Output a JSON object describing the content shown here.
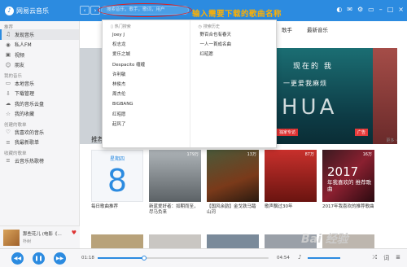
{
  "app": {
    "name": "网易云音乐"
  },
  "search": {
    "placeholder": "搜索音乐，歌手，歌词，用户"
  },
  "annotation": {
    "text": "输入需要下载的歌曲名称"
  },
  "nav": {
    "back": "‹",
    "forward": "›"
  },
  "sidebar": {
    "section_recommend": "推荐",
    "recommend_items": [
      {
        "icon": "music-note-icon",
        "label": "发现音乐"
      },
      {
        "icon": "radio-icon",
        "label": "私人FM"
      },
      {
        "icon": "video-icon",
        "label": "视频"
      },
      {
        "icon": "friends-icon",
        "label": "朋友"
      }
    ],
    "section_my_music": "我的音乐",
    "my_music_items": [
      {
        "icon": "computer-icon",
        "label": "本地音乐"
      },
      {
        "icon": "download-icon",
        "label": "下载管理"
      },
      {
        "icon": "cloud-icon",
        "label": "我的音乐云盘"
      },
      {
        "icon": "collect-icon",
        "label": "我的收藏"
      }
    ],
    "section_created": "创建的歌单",
    "created_items": [
      {
        "icon": "heart-icon",
        "label": "我喜欢的音乐"
      },
      {
        "icon": "playlist-icon",
        "label": "我最新歌单"
      }
    ],
    "section_collected": "收藏的歌单",
    "collected_items": [
      {
        "icon": "playlist-icon",
        "label": "云音乐热歌榜"
      }
    ]
  },
  "mini_player": {
    "title": "那些花儿 (电影《…",
    "artist": "朴树"
  },
  "tabs": [
    "歌手",
    "最新音乐"
  ],
  "dropdown": {
    "hot_header": "热门搜索",
    "hot": [
      "Joey J",
      "权志龙",
      "爱乐之城",
      "Despacito 缠缠",
      "许利敏",
      "林俊杰",
      "周杰伦",
      "BIGBANG",
      "红昭愿",
      "起风了"
    ],
    "history_header": "搜索历史",
    "history": [
      "野百合也有春天",
      "一人一首成名曲",
      "红昭愿"
    ]
  },
  "banner": {
    "line1": "现在的 我",
    "line2": "一更爱我麻烦",
    "big": "HUA",
    "exclusive": "独家专访",
    "ad": "广告"
  },
  "section": {
    "title": "推荐歌单",
    "more": "更多 ›"
  },
  "cards": [
    {
      "caption": "每日歌曲推荐",
      "weekday": "星期四",
      "day": "8",
      "count": ""
    },
    {
      "caption": "新蓝爱好者：如期而至，尽马负来",
      "count": "179万"
    },
    {
      "caption": "【国风余韵】金戈铁马踏山河",
      "count": "13万"
    },
    {
      "caption": "歌声飘过30年",
      "count": "87万"
    },
    {
      "caption": "2017年我喜欢的推荐歌曲",
      "count": "16万",
      "year": "2017",
      "sub": "年我喜欢的\n推荐歌曲"
    }
  ],
  "row2_counts": [
    "",
    "",
    "",
    "",
    ""
  ],
  "player": {
    "current": "01:18",
    "total": "04:54",
    "progress": 0.27
  },
  "watermark": "Bai 经验",
  "colors": {
    "accent": "#2c8be0",
    "annotation": "#ffb000",
    "annotation_circle": "#e02020"
  }
}
